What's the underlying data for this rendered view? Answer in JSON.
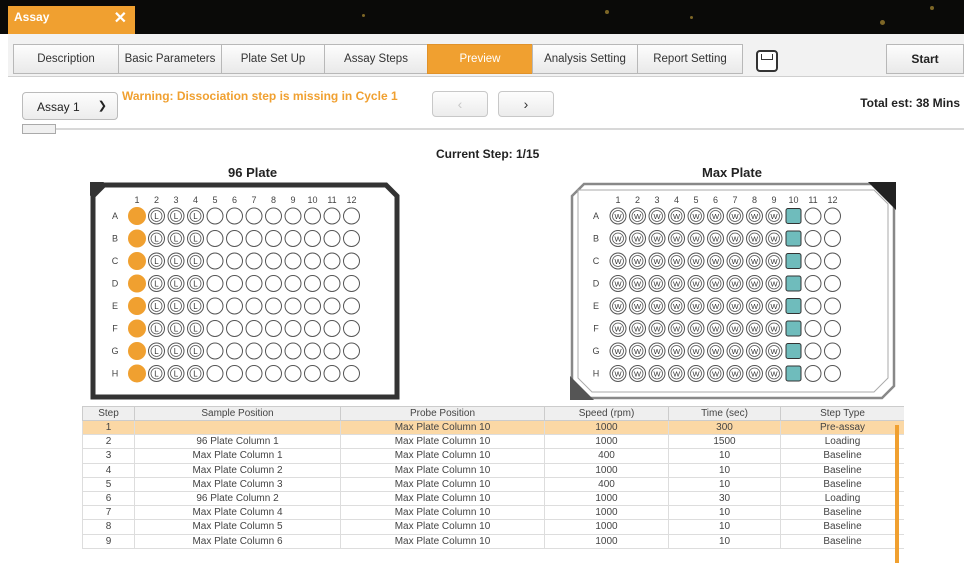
{
  "window": {
    "tab_title": "Assay",
    "close_glyph": "✕"
  },
  "tabs": [
    "Description",
    "Basic Parameters",
    "Plate Set Up",
    "Assay Steps",
    "Preview",
    "Analysis Setting",
    "Report Setting"
  ],
  "active_tab": "Preview",
  "start_label": "Start",
  "assay_select": {
    "value": "Assay 1"
  },
  "warning": "Warning: Dissociation step is missing in Cycle 1",
  "nav": {
    "prev": "‹",
    "next": "›"
  },
  "total_est": "Total est: 38 Mins",
  "current_step": "Current Step: 1/15",
  "plate96": {
    "title": "96 Plate",
    "cols": [
      "1",
      "2",
      "3",
      "4",
      "5",
      "6",
      "7",
      "8",
      "9",
      "10",
      "11",
      "12"
    ],
    "rows": [
      "A",
      "B",
      "C",
      "D",
      "E",
      "F",
      "G",
      "H"
    ],
    "well_label": "L",
    "col_states": [
      "active",
      "L",
      "L",
      "L",
      "empty",
      "empty",
      "empty",
      "empty",
      "empty",
      "empty",
      "empty",
      "empty"
    ]
  },
  "platemax": {
    "title": "Max Plate",
    "cols": [
      "1",
      "2",
      "3",
      "4",
      "5",
      "6",
      "7",
      "8",
      "9",
      "10",
      "11",
      "12"
    ],
    "rows": [
      "A",
      "B",
      "C",
      "D",
      "E",
      "F",
      "G",
      "H"
    ],
    "well_label": "W",
    "col_states": [
      "W",
      "W",
      "W",
      "W",
      "W",
      "W",
      "W",
      "W",
      "W",
      "probe",
      "empty",
      "empty"
    ]
  },
  "colors": {
    "accent": "#f0a030",
    "probe": "#6fbcbc",
    "highlight_row": "#fbd8a5"
  },
  "table": {
    "headers": [
      "Step",
      "Sample Position",
      "Probe Position",
      "Speed (rpm)",
      "Time (sec)",
      "Step Type"
    ],
    "rows": [
      [
        "1",
        "",
        "Max Plate Column 10",
        "1000",
        "300",
        "Pre-assay"
      ],
      [
        "2",
        "96 Plate Column 1",
        "Max Plate Column 10",
        "1000",
        "1500",
        "Loading"
      ],
      [
        "3",
        "Max Plate Column 1",
        "Max Plate Column 10",
        "400",
        "10",
        "Baseline"
      ],
      [
        "4",
        "Max Plate Column 2",
        "Max Plate Column 10",
        "1000",
        "10",
        "Baseline"
      ],
      [
        "5",
        "Max Plate Column 3",
        "Max Plate Column 10",
        "400",
        "10",
        "Baseline"
      ],
      [
        "6",
        "96 Plate Column 2",
        "Max Plate Column 10",
        "1000",
        "30",
        "Loading"
      ],
      [
        "7",
        "Max Plate Column 4",
        "Max Plate Column 10",
        "1000",
        "10",
        "Baseline"
      ],
      [
        "8",
        "Max Plate Column 5",
        "Max Plate Column 10",
        "1000",
        "10",
        "Baseline"
      ],
      [
        "9",
        "Max Plate Column 6",
        "Max Plate Column 10",
        "1000",
        "10",
        "Baseline"
      ]
    ],
    "highlighted_row": 0
  }
}
